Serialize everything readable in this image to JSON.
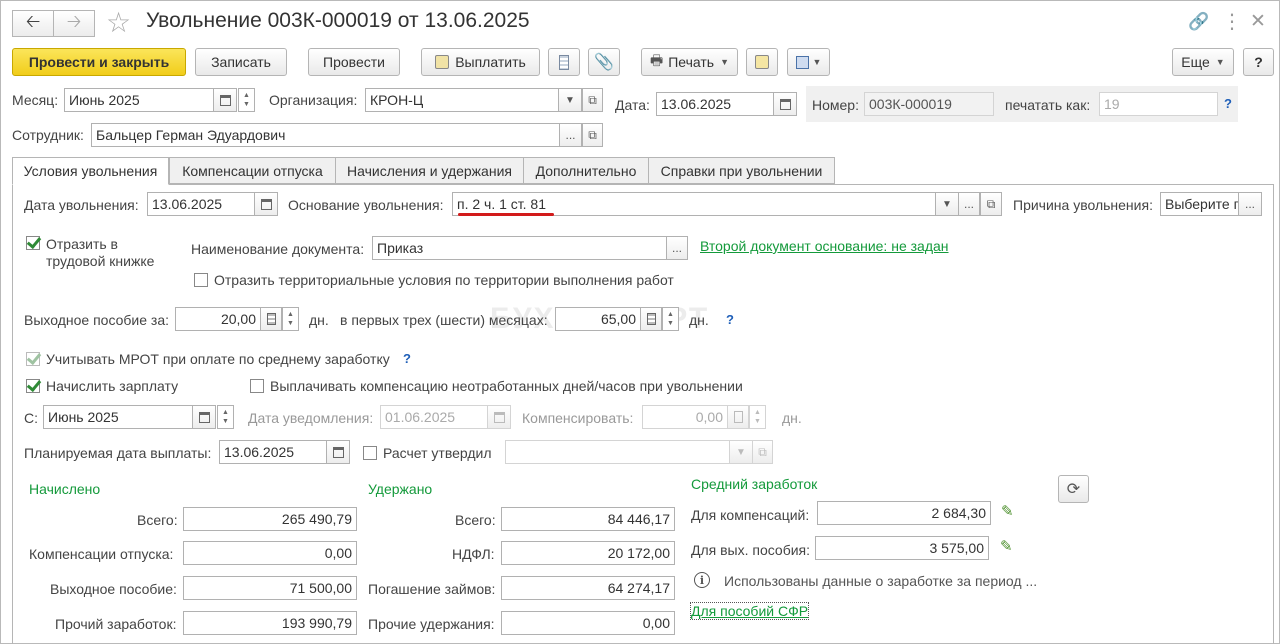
{
  "window": {
    "title": "Увольнение 003К-000019 от 13.06.2025",
    "back_icon": "arrow-left-icon",
    "forward_icon": "arrow-right-icon",
    "star_icon": "star-icon",
    "link_icon": "link-icon",
    "menu_icon": "more-vertical-icon",
    "close_icon": "close-icon"
  },
  "toolbar": {
    "post_close": "Провести и закрыть",
    "save": "Записать",
    "post": "Провести",
    "pay": "Выплатить",
    "print": "Печать",
    "more": "Еще",
    "help": "?"
  },
  "header": {
    "month_label": "Месяц:",
    "month_value": "Июнь 2025",
    "org_label": "Организация:",
    "org_value": "КРОН-Ц",
    "date_label": "Дата:",
    "date_value": "13.06.2025",
    "number_label": "Номер:",
    "number_value": "003К-000019",
    "print_as_label": "печатать как:",
    "print_as_value": "19",
    "employee_label": "Сотрудник:",
    "employee_value": "Бальцер Герман Эдуардович"
  },
  "tabs": [
    {
      "label": "Условия увольнения"
    },
    {
      "label": "Компенсации отпуска"
    },
    {
      "label": "Начисления и удержания"
    },
    {
      "label": "Дополнительно"
    },
    {
      "label": "Справки при увольнении"
    }
  ],
  "conditions": {
    "dismissal_date_label": "Дата увольнения:",
    "dismissal_date_value": "13.06.2025",
    "basis_label": "Основание увольнения:",
    "basis_value": "п. 2 ч. 1 ст. 81",
    "reason_label": "Причина увольнения:",
    "reason_value": "Выберите причину",
    "workbook_label_1": "Отразить в",
    "workbook_label_2": "трудовой книжке",
    "doc_name_label": "Наименование документа:",
    "doc_name_value": "Приказ",
    "second_doc_link": "Второй документ основание: не задан",
    "territorial_label": "Отразить территориальные условия по территории выполнения работ",
    "severance_label": "Выходное пособие за:",
    "severance_value": "20,00",
    "days_unit": "дн.",
    "first_months_label": "в первых трех (шести) месяцах:",
    "first_months_value": "65,00",
    "mrot_label": "Учитывать МРОТ при оплате по среднему заработку",
    "salary_label": "Начислить зарплату",
    "compensate_days_label": "Выплачивать компенсацию неотработанных дней/часов при увольнении",
    "from_label": "С:",
    "from_value": "Июнь 2025",
    "notice_date_label": "Дата уведомления:",
    "notice_date_value": "01.06.2025",
    "compensate_label": "Компенсировать:",
    "compensate_value": "0,00",
    "planned_date_label": "Планируемая дата выплаты:",
    "planned_date_value": "13.06.2025",
    "approved_label": "Расчет утвердил",
    "approved_value": "",
    "watermark": "БУХЭКСПЕРТ"
  },
  "accrued": {
    "title": "Начислено",
    "total_label": "Всего:",
    "total_value": "265 490,79",
    "vacation_comp_label": "Компенсации отпуска:",
    "vacation_comp_value": "0,00",
    "severance_label": "Выходное пособие:",
    "severance_value": "71 500,00",
    "other_label": "Прочий заработок:",
    "other_value": "193 990,79"
  },
  "withheld": {
    "title": "Удержано",
    "total_label": "Всего:",
    "total_value": "84 446,17",
    "ndfl_label": "НДФЛ:",
    "ndfl_value": "20 172,00",
    "loans_label": "Погашение займов:",
    "loans_value": "64 274,17",
    "other_label": "Прочие удержания:",
    "other_value": "0,00"
  },
  "average": {
    "title": "Средний заработок",
    "comp_label": "Для компенсаций:",
    "comp_value": "2 684,30",
    "severance_label": "Для вых. пособия:",
    "severance_value": "3 575,00",
    "info_text": "Использованы данные о заработке за период ...",
    "sfr_link": "Для пособий СФР"
  }
}
